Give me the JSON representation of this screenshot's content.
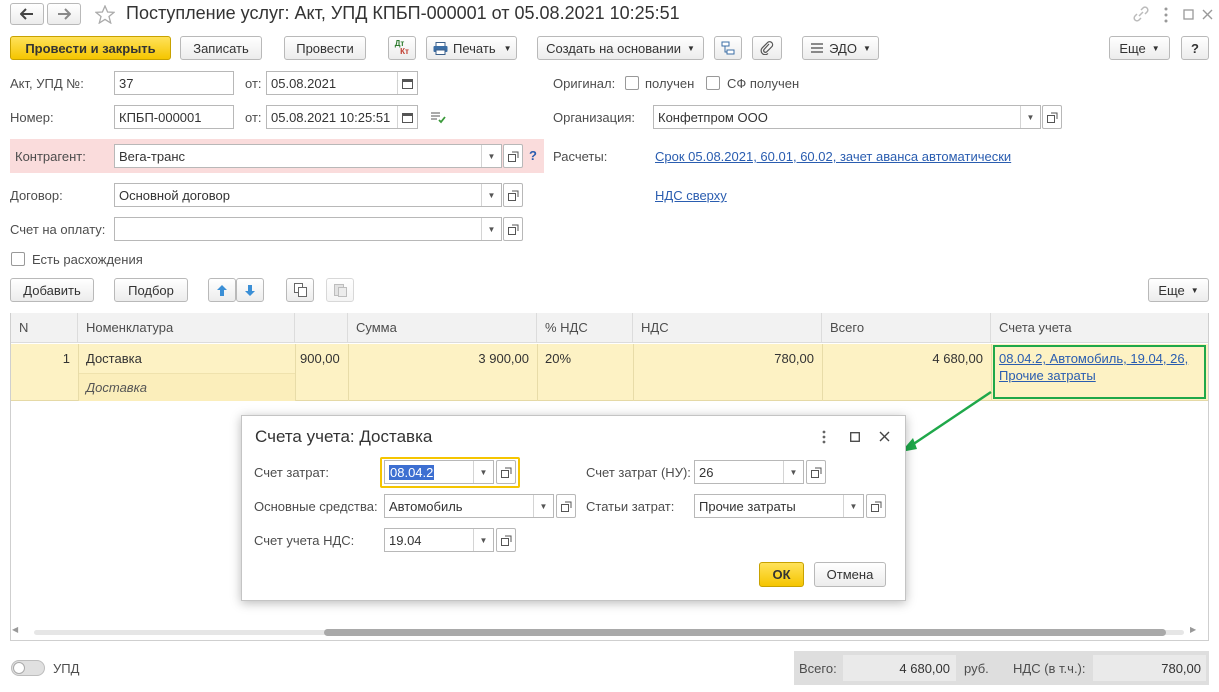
{
  "window": {
    "title": "Поступление услуг: Акт, УПД КПБП-000001 от 05.08.2021 10:25:51"
  },
  "toolbar": {
    "post_close": "Провести и закрыть",
    "save": "Записать",
    "post": "Провести",
    "dtkt_top": "Дт",
    "dtkt_bottom": "Кт",
    "print": "Печать",
    "create_based": "Создать на основании",
    "edo": "ЭДО",
    "more": "Еще",
    "help": "?"
  },
  "form": {
    "act_label": "Акт, УПД №:",
    "act_value": "37",
    "from_label": "от:",
    "act_date": "05.08.2021",
    "number_label": "Номер:",
    "number_value": "КПБП-000001",
    "number_datetime": "05.08.2021 10:25:51",
    "counterparty_label": "Контрагент:",
    "counterparty_value": "Вега-транс",
    "question": "?",
    "contract_label": "Договор:",
    "contract_value": "Основной договор",
    "invoice_label": "Счет на оплату:",
    "invoice_value": "",
    "discrepancy_label": "Есть расхождения",
    "original_label": "Оригинал:",
    "received_label": "получен",
    "sf_received_label": "СФ получен",
    "org_label": "Организация:",
    "org_value": "Конфетпром ООО",
    "settlements_label": "Расчеты:",
    "settlements_link": "Срок 05.08.2021, 60.01, 60.02, зачет аванса автоматически",
    "vat_link": "НДС сверху"
  },
  "table_toolbar": {
    "add": "Добавить",
    "pick": "Подбор",
    "more": "Еще"
  },
  "table": {
    "headers": [
      "N",
      "Номенклатура",
      "",
      "Сумма",
      "% НДС",
      "НДС",
      "Всего",
      "Счета учета"
    ],
    "rows": [
      {
        "n": "1",
        "nomenclature": "Доставка",
        "nomenclature_sub": "Доставка",
        "price": "900,00",
        "sum": "3 900,00",
        "vat_rate": "20%",
        "vat": "780,00",
        "total": "4 680,00",
        "accounts_line1": "08.04.2, Автомобиль, 19.04, 26,",
        "accounts_line2": "Прочие затраты"
      }
    ]
  },
  "dialog": {
    "title": "Счета учета: Доставка",
    "cost_account_label": "Счет затрат:",
    "cost_account_value": "08.04.2",
    "cost_account_tax_label": "Счет затрат (НУ):",
    "cost_account_tax_value": "26",
    "fixed_assets_label": "Основные средства:",
    "fixed_assets_value": "Автомобиль",
    "cost_items_label": "Статьи затрат:",
    "cost_items_value": "Прочие затраты",
    "vat_account_label": "Счет учета НДС:",
    "vat_account_value": "19.04",
    "ok": "ОК",
    "cancel": "Отмена"
  },
  "footer": {
    "upd_label": "УПД",
    "total_label": "Всего:",
    "total_value": "4 680,00",
    "currency": "руб.",
    "vat_label": "НДС (в т.ч.):",
    "vat_value": "780,00"
  },
  "colors": {
    "accent_yellow": "#f5c500",
    "row_highlight": "#fdf2c4",
    "counterparty_bg": "#fadcdc",
    "link": "#2a5db0",
    "green_arrow": "#1fa84a"
  }
}
